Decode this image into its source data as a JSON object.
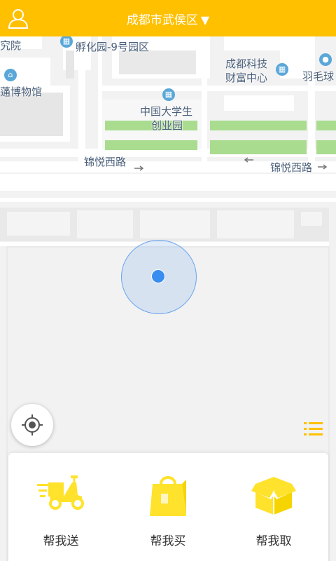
{
  "header": {
    "city": "成都市武侯区",
    "city_arrow": "▼",
    "user_icon": "user-icon"
  },
  "map": {
    "labels": {
      "incubator": "孵化园-9号园区",
      "research": "究院",
      "museum": "蓪博物馆",
      "tech_center_1": "成都科技",
      "tech_center_2": "财富中心",
      "badminton": "羽毛球",
      "univ_1": "中国大学生",
      "univ_2": "创业园",
      "road_left": "锦悦西路",
      "road_right": "锦悦西路"
    },
    "colors": {
      "background": "#f2f2f2",
      "road": "#ffffff",
      "green": "#a9dc8f",
      "building": "#ffffff",
      "accent": "#ffc000"
    }
  },
  "controls": {
    "locate_icon": "locate-icon",
    "list_icon": "list-icon"
  },
  "services": [
    {
      "label": "帮我送",
      "icon": "scooter-icon"
    },
    {
      "label": "帮我买",
      "icon": "shopping-bag-icon"
    },
    {
      "label": "帮我取",
      "icon": "box-icon"
    }
  ]
}
